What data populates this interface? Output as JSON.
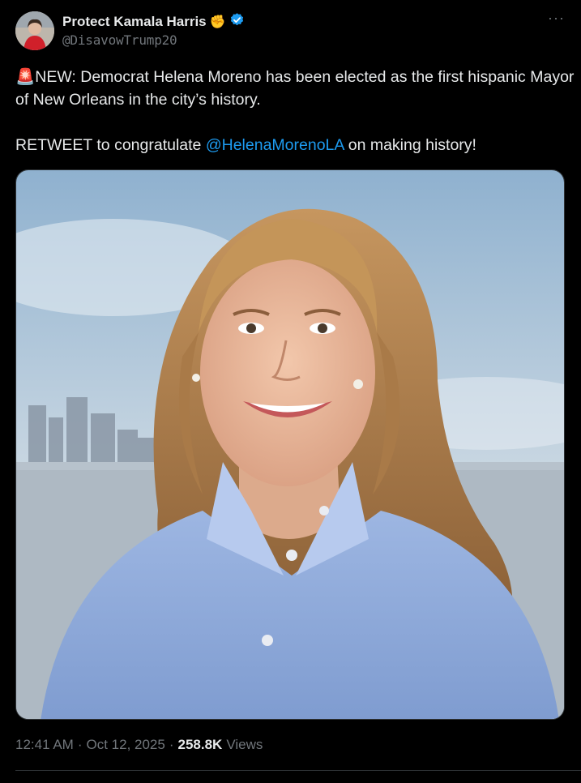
{
  "author": {
    "name": "Protect Kamala Harris",
    "name_emoji": "✊",
    "handle": "@DisavowTrump20",
    "verified": true
  },
  "menu": {
    "more_label": "···"
  },
  "tweet": {
    "alert_emoji": "🚨",
    "line1": "NEW: Democrat Helena Moreno has been elected as the first hispanic Mayor of New Orleans in the city’s history.",
    "line2_prefix": "RETWEET to congratulate ",
    "mention": "@HelenaMorenoLA",
    "line2_suffix": " on making history!"
  },
  "meta": {
    "time": "12:41 AM",
    "dot1": "·",
    "date": "Oct 12, 2025",
    "dot2": "·",
    "views_count": "258.8K",
    "views_label": "Views"
  },
  "colors": {
    "accent": "#1d9bf0",
    "muted": "#71767b",
    "text": "#e7e9ea",
    "bg": "#000000"
  }
}
